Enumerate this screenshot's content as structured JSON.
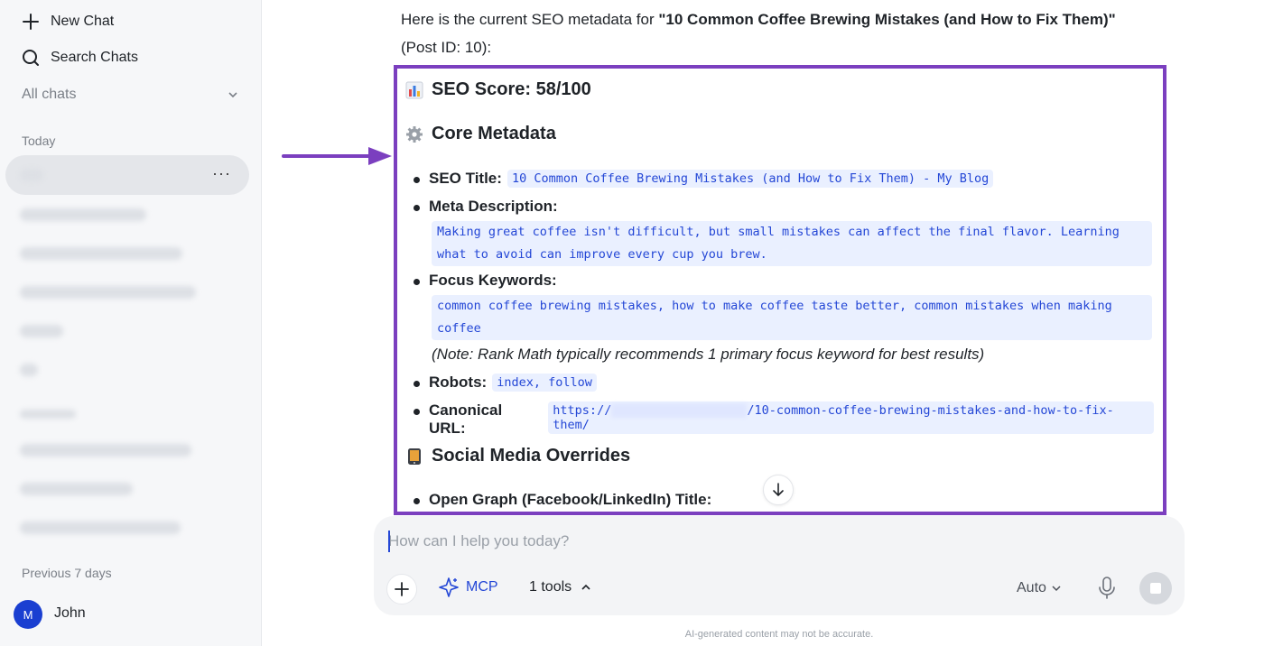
{
  "sidebar": {
    "new_chat": "New Chat",
    "search_chats": "Search Chats",
    "all_chats": "All chats",
    "section_today": "Today",
    "section_previous": "Previous 7 days",
    "user_initial": "M",
    "user_name": "John"
  },
  "message": {
    "intro_prefix": "Here is the current SEO metadata for ",
    "post_title": "\"10 Common Coffee Brewing Mistakes (and How to Fix Them)\"",
    "intro_suffix": "(Post ID: 10):",
    "seo_score": "SEO Score: 58/100",
    "core_heading": "Core Metadata",
    "seo_title_label": "SEO Title:",
    "seo_title_value": "10 Common Coffee Brewing Mistakes (and How to Fix Them) - My Blog",
    "meta_desc_label": "Meta Description:",
    "meta_desc_value": "Making great coffee isn't difficult, but small mistakes can affect the final flavor. Learning what to avoid can improve every cup you brew.",
    "focus_kw_label": "Focus Keywords:",
    "focus_kw_value": "common coffee brewing mistakes, how to make coffee taste better, common mistakes when making coffee",
    "note": "(Note: Rank Math typically recommends 1 primary focus keyword for best results)",
    "robots_label": "Robots:",
    "robots_value": "index, follow",
    "canonical_label": "Canonical URL:",
    "canonical_prefix": "https://",
    "canonical_suffix": "/10-common-coffee-brewing-mistakes-and-how-to-fix-them/",
    "social_heading": "Social Media Overrides",
    "og_title_label": "Open Graph (Facebook/LinkedIn) Title:"
  },
  "composer": {
    "placeholder": "How can I help you today?",
    "mcp_label": "MCP",
    "tools_label": "1 tools",
    "model_label": "Auto"
  },
  "footer": {
    "disclaimer": "AI-generated content may not be accurate."
  },
  "colors": {
    "accent": "#2447d6",
    "frame": "#7b3fbf"
  }
}
